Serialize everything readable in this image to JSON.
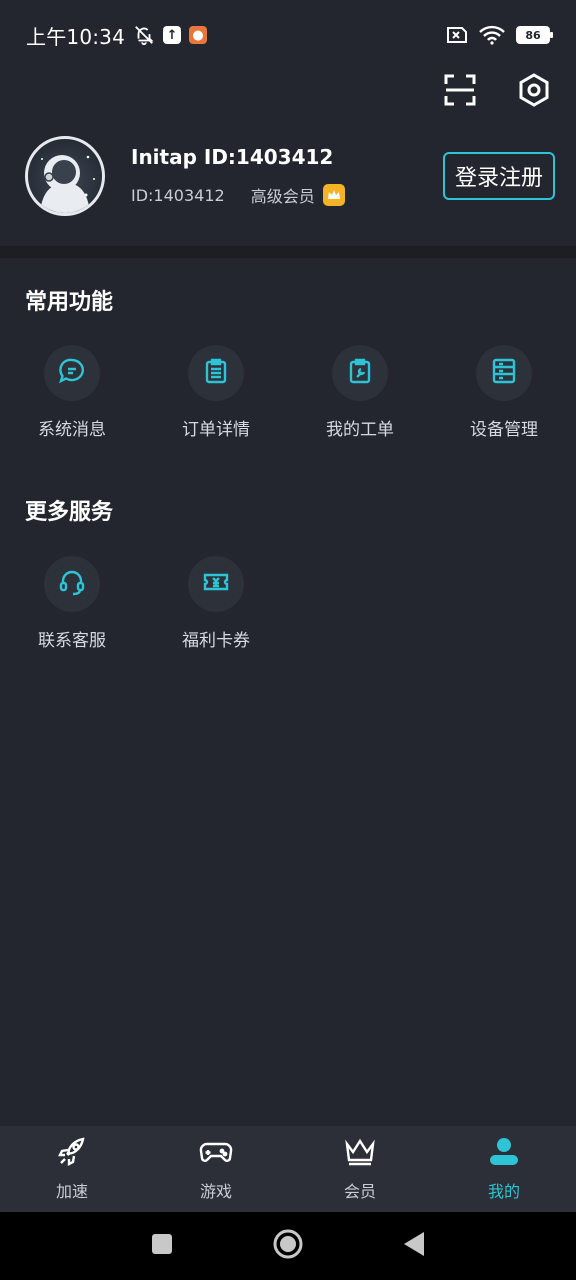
{
  "status_bar": {
    "time": "上午10:34",
    "battery": "86"
  },
  "profile": {
    "name": "Initap ID:1403412",
    "id_text": "ID:1403412",
    "level": "高级会员",
    "login_button": "登录注册"
  },
  "common": {
    "title": "常用功能",
    "items": [
      {
        "label": "系统消息"
      },
      {
        "label": "订单详情"
      },
      {
        "label": "我的工单"
      },
      {
        "label": "设备管理"
      }
    ]
  },
  "more": {
    "title": "更多服务",
    "items": [
      {
        "label": "联系客服"
      },
      {
        "label": "福利卡券"
      }
    ]
  },
  "bottom_nav": {
    "items": [
      {
        "label": "加速",
        "icon": "rocket-icon"
      },
      {
        "label": "游戏",
        "icon": "gamepad-icon"
      },
      {
        "label": "会员",
        "icon": "crown-icon"
      },
      {
        "label": "我的",
        "icon": "user-icon",
        "active": true
      }
    ]
  },
  "colors": {
    "background": "#23262e",
    "accent": "#2ec4d6",
    "vip_badge": "#f4b324"
  }
}
